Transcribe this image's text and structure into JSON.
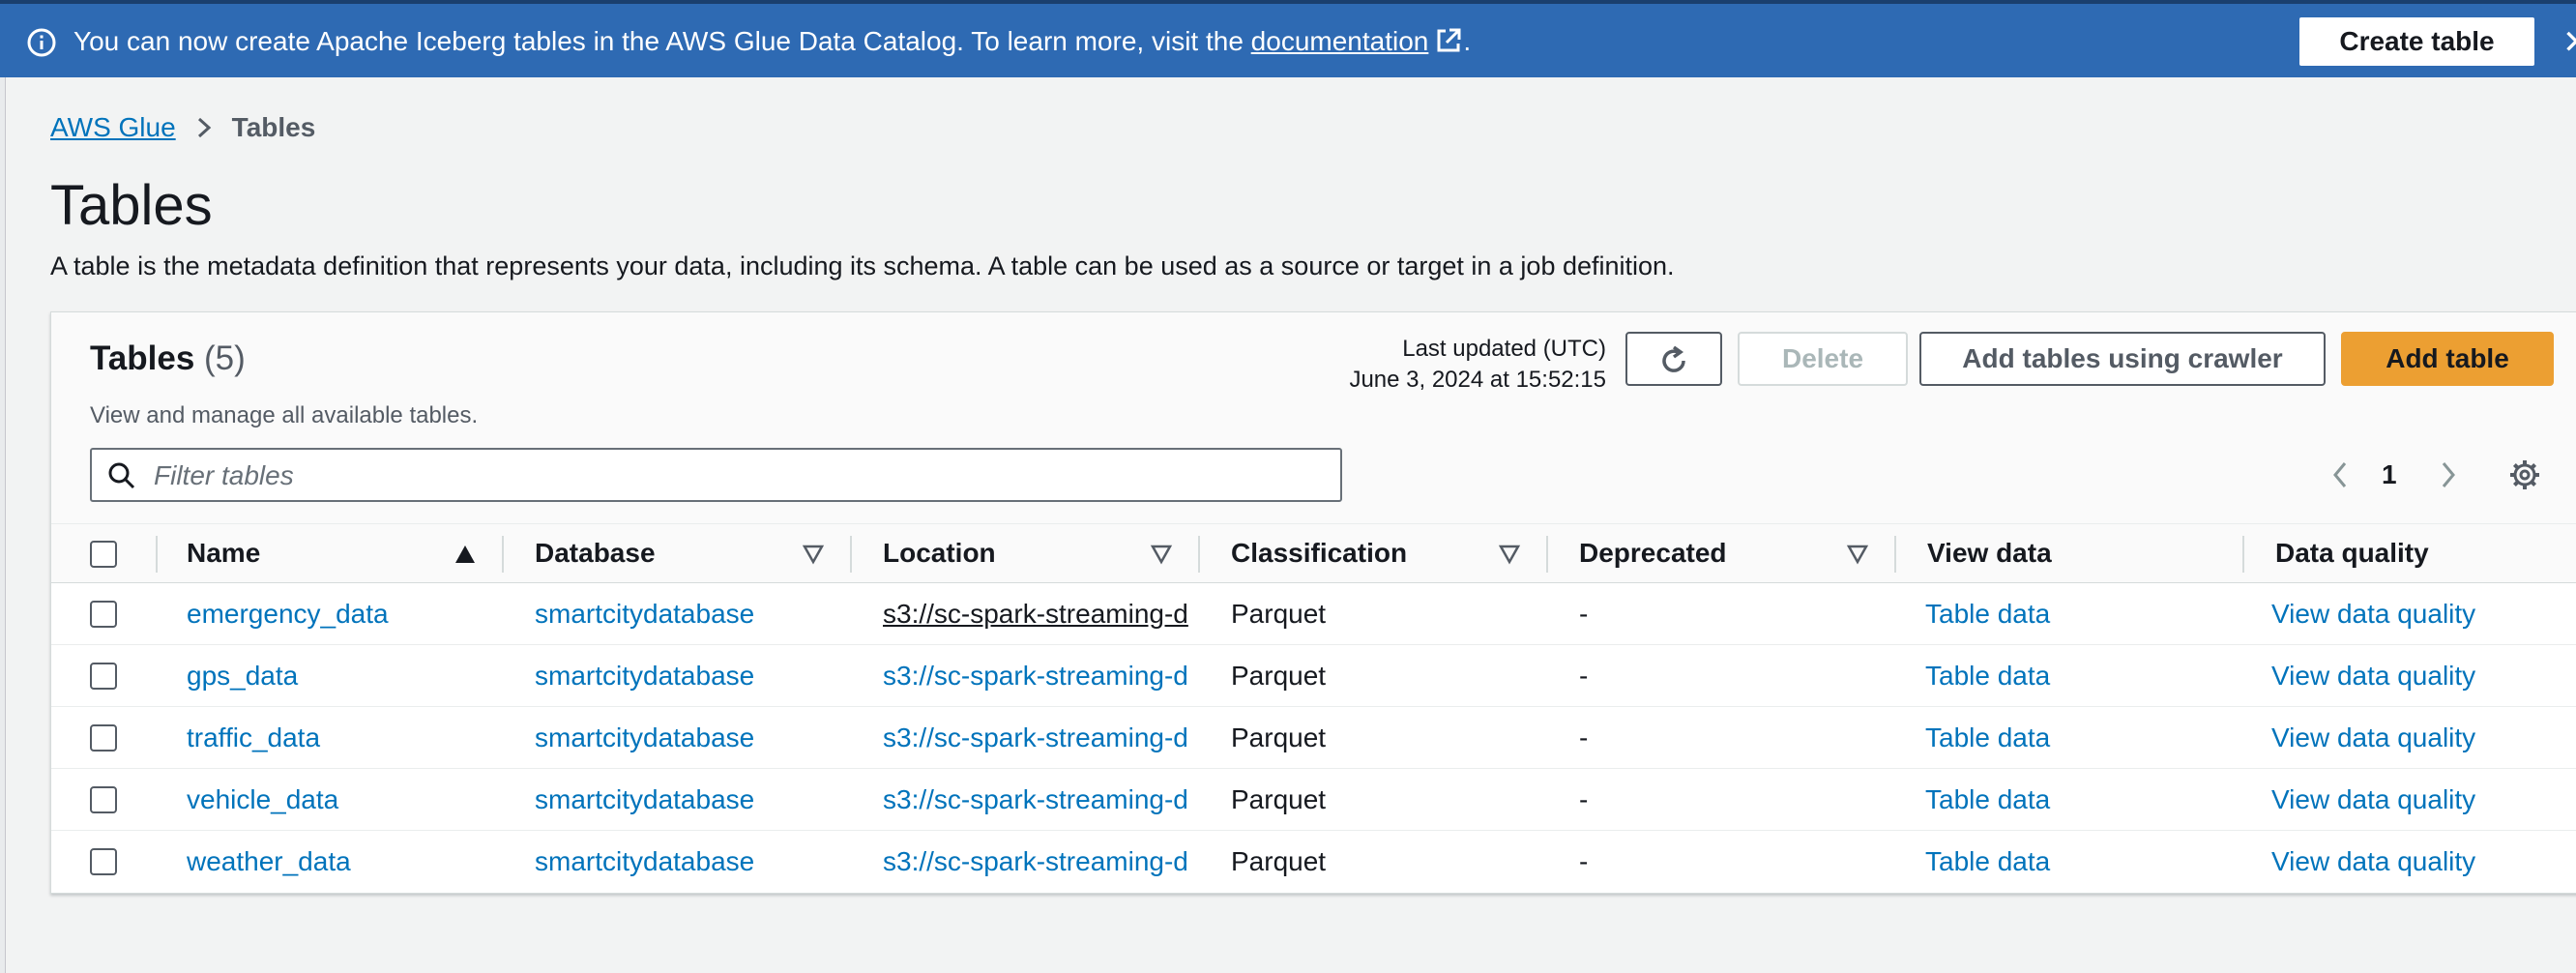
{
  "banner": {
    "message_prefix": "You can now create Apache Iceberg tables in the AWS Glue Data Catalog. To learn more, visit the ",
    "link_label": "documentation",
    "message_suffix": ".",
    "create_table_label": "Create table"
  },
  "breadcrumb": {
    "root": "AWS Glue",
    "current": "Tables"
  },
  "page": {
    "title": "Tables",
    "description": "A table is the metadata definition that represents your data, including its schema. A table can be used as a source or target in a job definition."
  },
  "panel": {
    "title": "Tables",
    "count": "(5)",
    "description": "View and manage all available tables.",
    "last_updated_label": "Last updated (UTC)",
    "last_updated_value": "June 3, 2024 at 15:52:15",
    "delete_label": "Delete",
    "crawler_label": "Add tables using crawler",
    "add_label": "Add table",
    "filter_placeholder": "Filter tables",
    "page_number": "1"
  },
  "table": {
    "columns": [
      "Name",
      "Database",
      "Location",
      "Classification",
      "Deprecated",
      "View data",
      "Data quality"
    ],
    "rows": [
      {
        "name": "emergency_data",
        "database": "smartcitydatabase",
        "location": "s3://sc-spark-streaming-d",
        "classification": "Parquet",
        "deprecated": "-",
        "view_data": "Table data",
        "data_quality": "View data quality"
      },
      {
        "name": "gps_data",
        "database": "smartcitydatabase",
        "location": "s3://sc-spark-streaming-d",
        "classification": "Parquet",
        "deprecated": "-",
        "view_data": "Table data",
        "data_quality": "View data quality"
      },
      {
        "name": "traffic_data",
        "database": "smartcitydatabase",
        "location": "s3://sc-spark-streaming-d",
        "classification": "Parquet",
        "deprecated": "-",
        "view_data": "Table data",
        "data_quality": "View data quality"
      },
      {
        "name": "vehicle_data",
        "database": "smartcitydatabase",
        "location": "s3://sc-spark-streaming-d",
        "classification": "Parquet",
        "deprecated": "-",
        "view_data": "Table data",
        "data_quality": "View data quality"
      },
      {
        "name": "weather_data",
        "database": "smartcitydatabase",
        "location": "s3://sc-spark-streaming-d",
        "classification": "Parquet",
        "deprecated": "-",
        "view_data": "Table data",
        "data_quality": "View data quality"
      }
    ]
  },
  "colors": {
    "banner_bg": "#2e6ab3",
    "link": "#0073bb",
    "primary_button": "#ec9f32"
  },
  "icons": [
    "info-icon",
    "external-link-icon",
    "close-icon",
    "chevron-right-icon",
    "refresh-icon",
    "search-icon",
    "chevron-left-icon",
    "gear-icon",
    "sort-ascending-icon",
    "sort-descending-icon"
  ]
}
